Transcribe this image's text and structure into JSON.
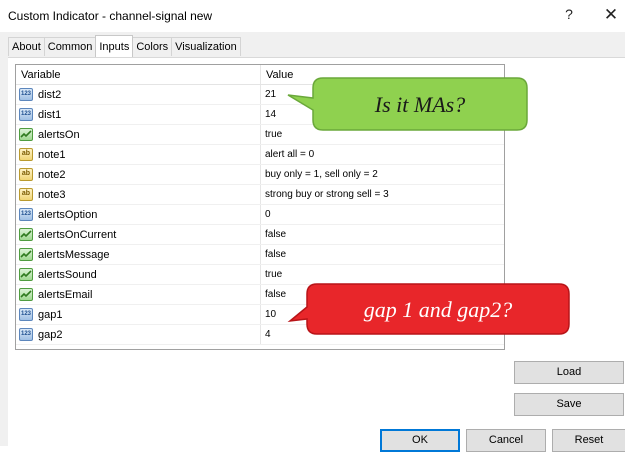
{
  "window": {
    "title": "Custom Indicator - channel-signal new",
    "help": "?",
    "close": "✕"
  },
  "tabs": [
    "About",
    "Common",
    "Inputs",
    "Colors",
    "Visualization"
  ],
  "active_tab": "Inputs",
  "table": {
    "headers": {
      "variable": "Variable",
      "value": "Value"
    },
    "rows": [
      {
        "type": "int",
        "name": "dist2",
        "value": "21"
      },
      {
        "type": "int",
        "name": "dist1",
        "value": "14"
      },
      {
        "type": "bool",
        "name": "alertsOn",
        "value": "true"
      },
      {
        "type": "str",
        "name": "note1",
        "value": "alert all = 0"
      },
      {
        "type": "str",
        "name": "note2",
        "value": "buy only = 1, sell only = 2"
      },
      {
        "type": "str",
        "name": "note3",
        "value": "strong buy or strong sell = 3"
      },
      {
        "type": "int",
        "name": "alertsOption",
        "value": "0"
      },
      {
        "type": "bool",
        "name": "alertsOnCurrent",
        "value": "false"
      },
      {
        "type": "bool",
        "name": "alertsMessage",
        "value": "false"
      },
      {
        "type": "bool",
        "name": "alertsSound",
        "value": "true"
      },
      {
        "type": "bool",
        "name": "alertsEmail",
        "value": "false"
      },
      {
        "type": "int",
        "name": "gap1",
        "value": "10"
      },
      {
        "type": "int",
        "name": "gap2",
        "value": "4"
      }
    ]
  },
  "icon_labels": {
    "int": "123",
    "str": "ab"
  },
  "annotations": {
    "green": {
      "text": "Is it MAs?",
      "color": "#8fd14f"
    },
    "red": {
      "text": "gap 1 and gap2?",
      "color": "#e8262a"
    }
  },
  "buttons": {
    "load": "Load",
    "save": "Save",
    "ok": "OK",
    "cancel": "Cancel",
    "reset": "Reset"
  }
}
